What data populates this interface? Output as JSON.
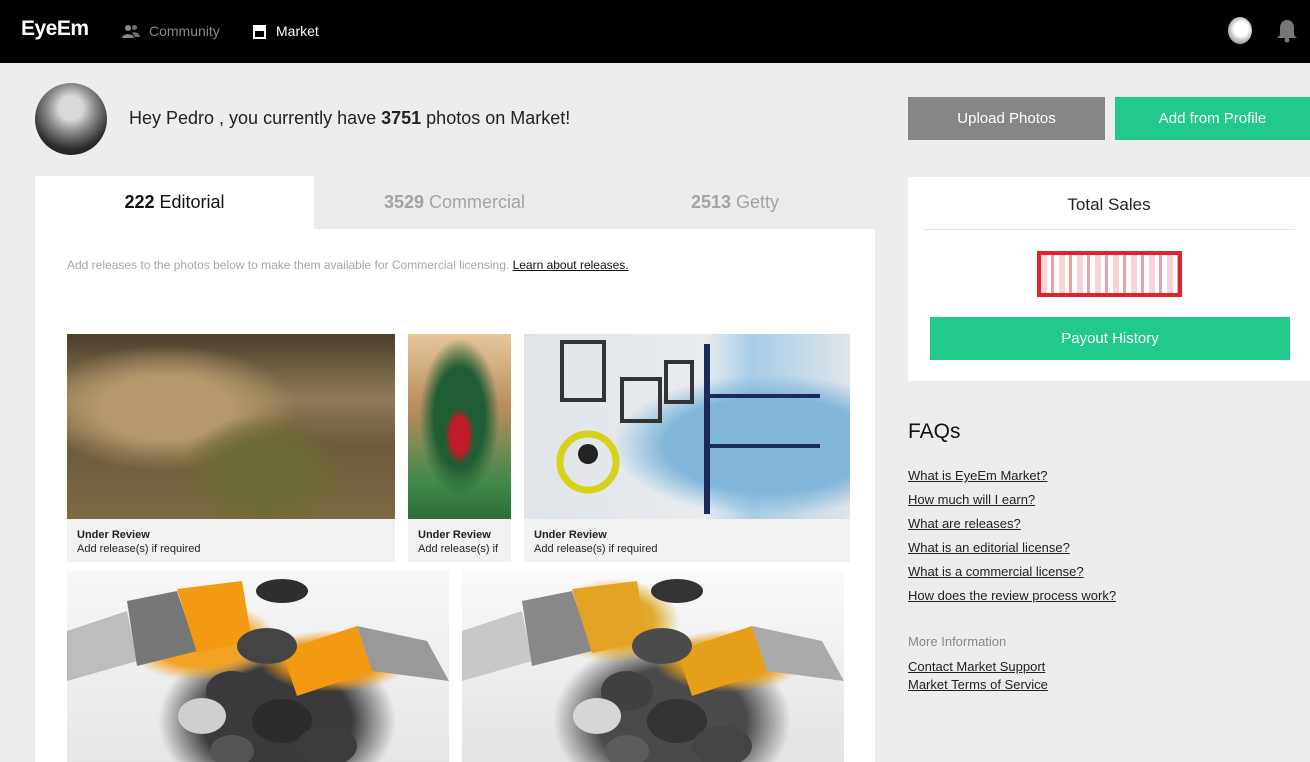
{
  "nav": {
    "logo": "EyeEm",
    "community": "Community",
    "market": "Market"
  },
  "greeting": {
    "prefix": "Hey Pedro , you currently have ",
    "count": "3751",
    "suffix": " photos on Market!"
  },
  "actions": {
    "upload": "Upload Photos",
    "add_from_profile": "Add from Profile"
  },
  "tabs": [
    {
      "count": "222",
      "label": "Editorial",
      "active": true
    },
    {
      "count": "3529",
      "label": "Commercial",
      "active": false
    },
    {
      "count": "2513",
      "label": "Getty",
      "active": false
    }
  ],
  "notice": {
    "text": "Add releases to the photos below to make them available for Commercial licensing. ",
    "link": "Learn about releases."
  },
  "photos": [
    {
      "status": "Under Review",
      "note": "Add release(s) if required",
      "subject": "nativity-scene"
    },
    {
      "status": "Under Review",
      "note": "Add release(s) if",
      "subject": "christmas-tree"
    },
    {
      "status": "Under Review",
      "note": "Add release(s) if required",
      "subject": "painted-wall"
    },
    {
      "subject": "paint-brushes-stones"
    },
    {
      "subject": "paint-brushes-stones-2"
    }
  ],
  "sales": {
    "title": "Total Sales",
    "payout_button": "Payout History"
  },
  "faqs": {
    "title": "FAQs",
    "items": [
      "What is EyeEm Market?",
      "How much will I earn?",
      "What are releases?",
      "What is an editorial license?",
      "What is a commercial license?",
      "How does the review process work?"
    ]
  },
  "more": {
    "title": "More Information",
    "links": [
      "Contact Market Support",
      "Market Terms of Service"
    ]
  },
  "colors": {
    "accent": "#21c98a",
    "nav_bg": "#000000",
    "secondary_button": "#868686"
  }
}
